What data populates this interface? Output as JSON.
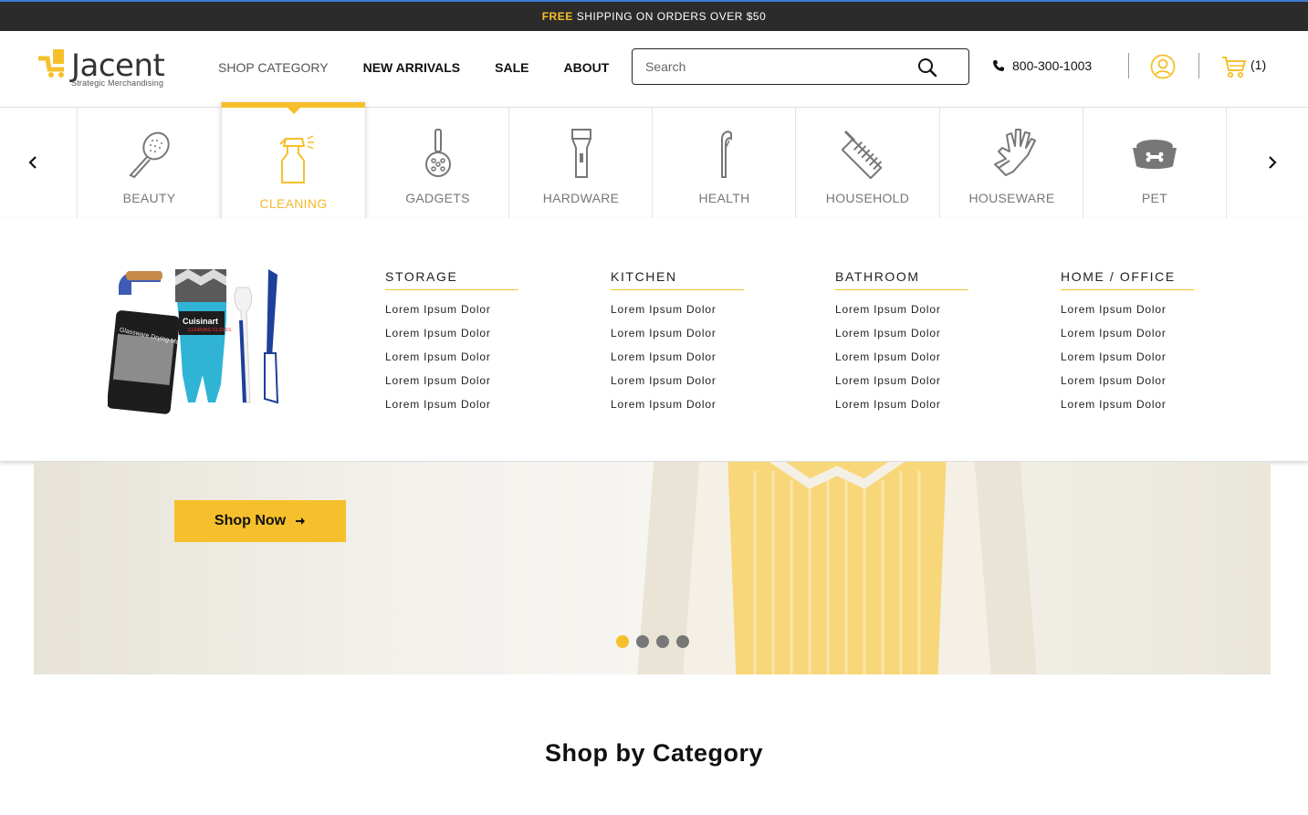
{
  "promo": {
    "free": "FREE",
    "text": "SHIPPING ON ORDERS OVER $50"
  },
  "logo": {
    "word": "Jacent",
    "tagline": "Strategic Merchandising",
    "mark": "logo-cart-icon"
  },
  "nav": [
    {
      "label": "SHOP CATEGORY"
    },
    {
      "label": "NEW ARRIVALS"
    },
    {
      "label": "SALE"
    },
    {
      "label": "ABOUT"
    }
  ],
  "search": {
    "placeholder": "Search",
    "value": ""
  },
  "phone": "800-300-1003",
  "cart": {
    "count": "(1)"
  },
  "categories": [
    {
      "label": "BEAUTY",
      "icon": "hairbrush-icon"
    },
    {
      "label": "CLEANING",
      "icon": "spray-bottle-icon",
      "active": true
    },
    {
      "label": "GADGETS",
      "icon": "kitchen-gadget-icon"
    },
    {
      "label": "HARDWARE",
      "icon": "flashlight-icon"
    },
    {
      "label": "HEALTH",
      "icon": "floss-pick-icon"
    },
    {
      "label": "HOUSEHOLD",
      "icon": "grater-icon"
    },
    {
      "label": "HOUSEWARE",
      "icon": "glove-icon"
    },
    {
      "label": "PET",
      "icon": "pet-bowl-icon"
    }
  ],
  "mega": {
    "columns": [
      {
        "title": "STORAGE",
        "links": [
          "Lorem Ipsum Dolor",
          "Lorem Ipsum Dolor",
          "Lorem Ipsum Dolor",
          "Lorem Ipsum Dolor",
          "Lorem Ipsum Dolor"
        ]
      },
      {
        "title": "KITCHEN",
        "links": [
          "Lorem Ipsum Dolor",
          "Lorem Ipsum Dolor",
          "Lorem Ipsum Dolor",
          "Lorem Ipsum Dolor",
          "Lorem Ipsum Dolor"
        ]
      },
      {
        "title": "BATHROOM",
        "links": [
          "Lorem Ipsum Dolor",
          "Lorem Ipsum Dolor",
          "Lorem Ipsum Dolor",
          "Lorem Ipsum Dolor",
          "Lorem Ipsum Dolor"
        ]
      },
      {
        "title": "HOME / OFFICE",
        "links": [
          "Lorem Ipsum Dolor",
          "Lorem Ipsum Dolor",
          "Lorem Ipsum Dolor",
          "Lorem Ipsum Dolor",
          "Lorem Ipsum Dolor"
        ]
      }
    ],
    "product_brand": "Cuisinart",
    "product_sub": "CLEANING GLOVES",
    "mat_text": "Glassware Drying Mat"
  },
  "hero": {
    "cta": "Shop Now",
    "slides": 4,
    "active_slide": 1
  },
  "section_title": "Shop by Category",
  "colors": {
    "accent": "#f5c02c",
    "dark": "#2b2b2b",
    "muted": "#777777"
  }
}
